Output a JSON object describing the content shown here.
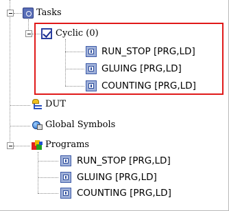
{
  "tree": {
    "tasks": {
      "label": "Tasks",
      "icon": "tasks-icon",
      "cyclic": {
        "label": "Cyclic (0)",
        "icon": "checkbox-icon",
        "items": [
          {
            "label": "RUN_STOP [PRG,LD]",
            "icon": "program-icon"
          },
          {
            "label": "GLUING [PRG,LD]",
            "icon": "program-icon"
          },
          {
            "label": "COUNTING [PRG,LD]",
            "icon": "program-icon"
          }
        ]
      }
    },
    "dut": {
      "label": "DUT",
      "icon": "dut-icon"
    },
    "global_symbols": {
      "label": "Global Symbols",
      "icon": "globe-icon"
    },
    "programs": {
      "label": "Programs",
      "icon": "programs-icon",
      "items": [
        {
          "label": "RUN_STOP [PRG,LD]",
          "icon": "program-icon"
        },
        {
          "label": "GLUING [PRG,LD]",
          "icon": "program-icon"
        },
        {
          "label": "COUNTING [PRG,LD]",
          "icon": "program-icon"
        }
      ]
    }
  },
  "colors": {
    "highlight": "#e01818",
    "tree_line": "#8a8a8a"
  }
}
